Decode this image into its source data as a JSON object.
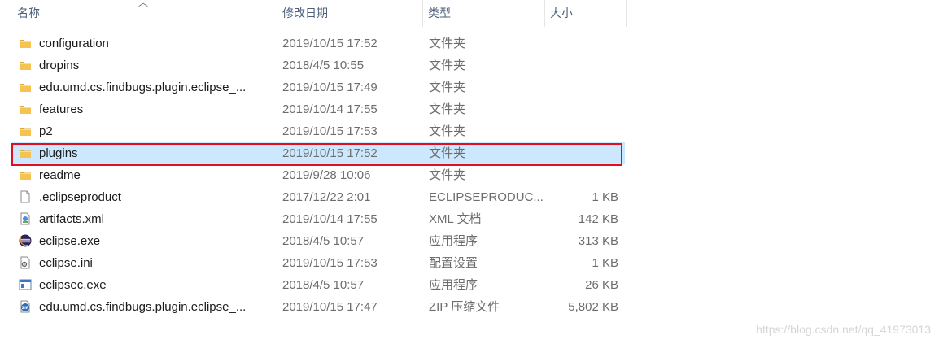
{
  "columns": {
    "name": "名称",
    "modified": "修改日期",
    "type": "类型",
    "size": "大小"
  },
  "rows": [
    {
      "name": "configuration",
      "modified": "2019/10/15 17:52",
      "type": "文件夹",
      "size": "",
      "icon": "folder-icon"
    },
    {
      "name": "dropins",
      "modified": "2018/4/5 10:55",
      "type": "文件夹",
      "size": "",
      "icon": "folder-icon"
    },
    {
      "name": "edu.umd.cs.findbugs.plugin.eclipse_...",
      "modified": "2019/10/15 17:49",
      "type": "文件夹",
      "size": "",
      "icon": "folder-icon"
    },
    {
      "name": "features",
      "modified": "2019/10/14 17:55",
      "type": "文件夹",
      "size": "",
      "icon": "folder-icon"
    },
    {
      "name": "p2",
      "modified": "2019/10/15 17:53",
      "type": "文件夹",
      "size": "",
      "icon": "folder-icon"
    },
    {
      "name": "plugins",
      "modified": "2019/10/15 17:52",
      "type": "文件夹",
      "size": "",
      "icon": "folder-icon",
      "selected": true
    },
    {
      "name": "readme",
      "modified": "2019/9/28 10:06",
      "type": "文件夹",
      "size": "",
      "icon": "folder-icon"
    },
    {
      "name": ".eclipseproduct",
      "modified": "2017/12/22 2:01",
      "type": "ECLIPSEPRODUC...",
      "size": "1 KB",
      "icon": "file-icon"
    },
    {
      "name": "artifacts.xml",
      "modified": "2019/10/14 17:55",
      "type": "XML 文档",
      "size": "142 KB",
      "icon": "xml-file-icon"
    },
    {
      "name": "eclipse.exe",
      "modified": "2018/4/5 10:57",
      "type": "应用程序",
      "size": "313 KB",
      "icon": "eclipse-icon"
    },
    {
      "name": "eclipse.ini",
      "modified": "2019/10/15 17:53",
      "type": "配置设置",
      "size": "1 KB",
      "icon": "settings-file-icon"
    },
    {
      "name": "eclipsec.exe",
      "modified": "2018/4/5 10:57",
      "type": "应用程序",
      "size": "26 KB",
      "icon": "app-window-icon"
    },
    {
      "name": "edu.umd.cs.findbugs.plugin.eclipse_...",
      "modified": "2019/10/15 17:47",
      "type": "ZIP 压缩文件",
      "size": "5,802 KB",
      "icon": "zip-file-icon"
    }
  ],
  "watermark": "https://blog.csdn.net/qq_41973013",
  "colors": {
    "selection": "#cce8ff",
    "highlight_border": "#e01020",
    "folder": "#f6c350"
  }
}
